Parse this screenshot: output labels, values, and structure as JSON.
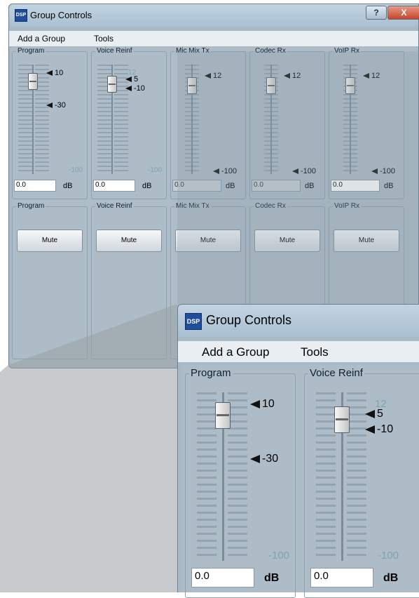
{
  "window": {
    "title": "Group Controls",
    "icon": "dsp-app-icon",
    "icon_text": "DSP",
    "help_button": "?",
    "close_button": "X"
  },
  "menu": [
    "Add a Group",
    "Tools"
  ],
  "unit": "dB",
  "mute_label": "Mute",
  "groups": [
    {
      "name": "Program",
      "level": "0.0",
      "markers": [
        "10",
        "-30"
      ],
      "ghost_top": "",
      "ghost_bottom": "-100",
      "mute_name": "Program"
    },
    {
      "name": "Voice Reinf",
      "level": "0.0",
      "markers": [
        "5",
        "-10"
      ],
      "ghost_top": "12",
      "ghost_bottom": "-100",
      "mute_name": "Voice Reinf"
    },
    {
      "name": "Mic Mix Tx",
      "level": "0.0",
      "markers": [
        "12",
        "-100"
      ],
      "ghost_top": "",
      "ghost_bottom": "",
      "mute_name": "Mic Mix Tx"
    },
    {
      "name": "Codec Rx",
      "level": "0.0",
      "markers": [
        "12",
        "-100"
      ],
      "ghost_top": "",
      "ghost_bottom": "",
      "mute_name": "Codec Rx"
    },
    {
      "name": "VoIP Rx",
      "level": "0.0",
      "markers": [
        "12",
        "-100"
      ],
      "ghost_top": "",
      "ghost_bottom": "",
      "mute_name": "VoIP Rx"
    }
  ],
  "colors": {
    "window_bg": "#a9bac6",
    "titlebar": "#b7cbdb",
    "menubar": "#e9eef3",
    "close": "#c8452d",
    "marker": "#111111"
  }
}
